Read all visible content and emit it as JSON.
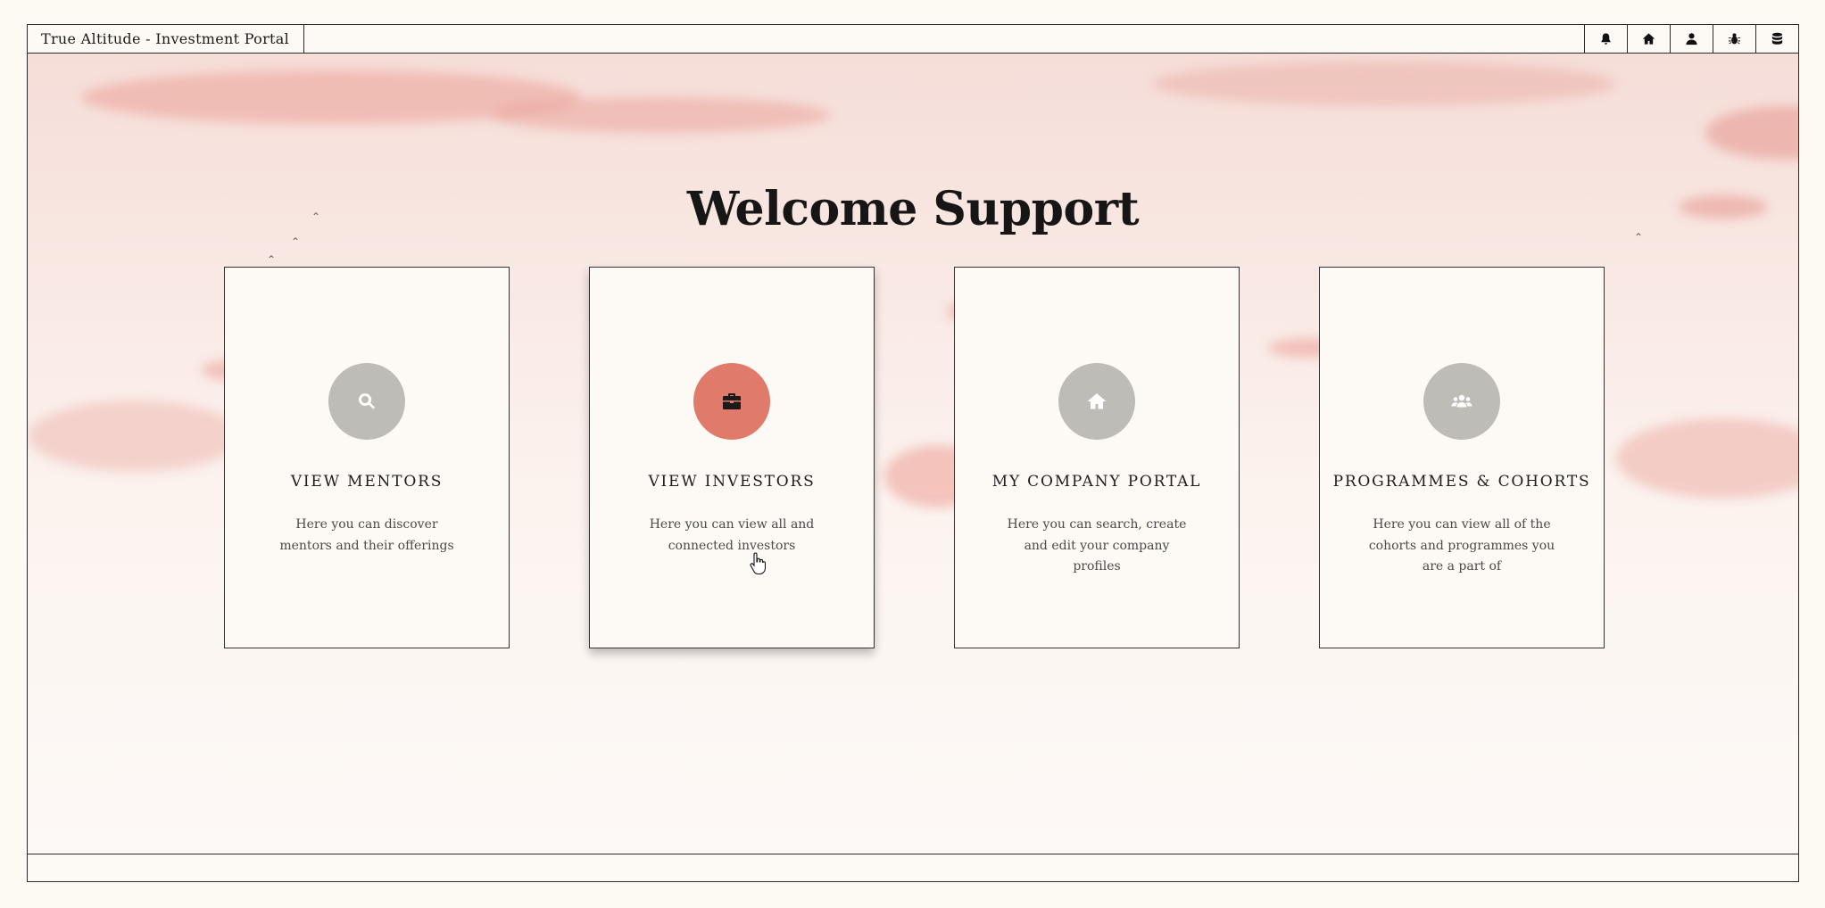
{
  "header": {
    "app_title": "True Altitude - Investment Portal",
    "icons": [
      "bell-icon",
      "home-icon",
      "user-icon",
      "bug-icon",
      "database-icon"
    ]
  },
  "main": {
    "welcome": "Welcome Support",
    "cards": [
      {
        "title": "VIEW MENTORS",
        "description": "Here you can discover mentors and their offerings",
        "icon": "search-icon"
      },
      {
        "title": "VIEW INVESTORS",
        "description": "Here you can view all and connected investors",
        "icon": "briefcase-icon",
        "active": true
      },
      {
        "title": "MY COMPANY PORTAL",
        "description": "Here you can search, create and edit your company profiles",
        "icon": "home-icon"
      },
      {
        "title": "PROGRAMMES & COHORTS",
        "description": "Here you can view all of the cohorts and programmes you are a part of",
        "icon": "users-icon"
      }
    ]
  },
  "colors": {
    "accent": "#e07a6a",
    "icon_circle": "#bebcb7",
    "background": "#fdfaf6",
    "border": "#2a2a2a"
  }
}
